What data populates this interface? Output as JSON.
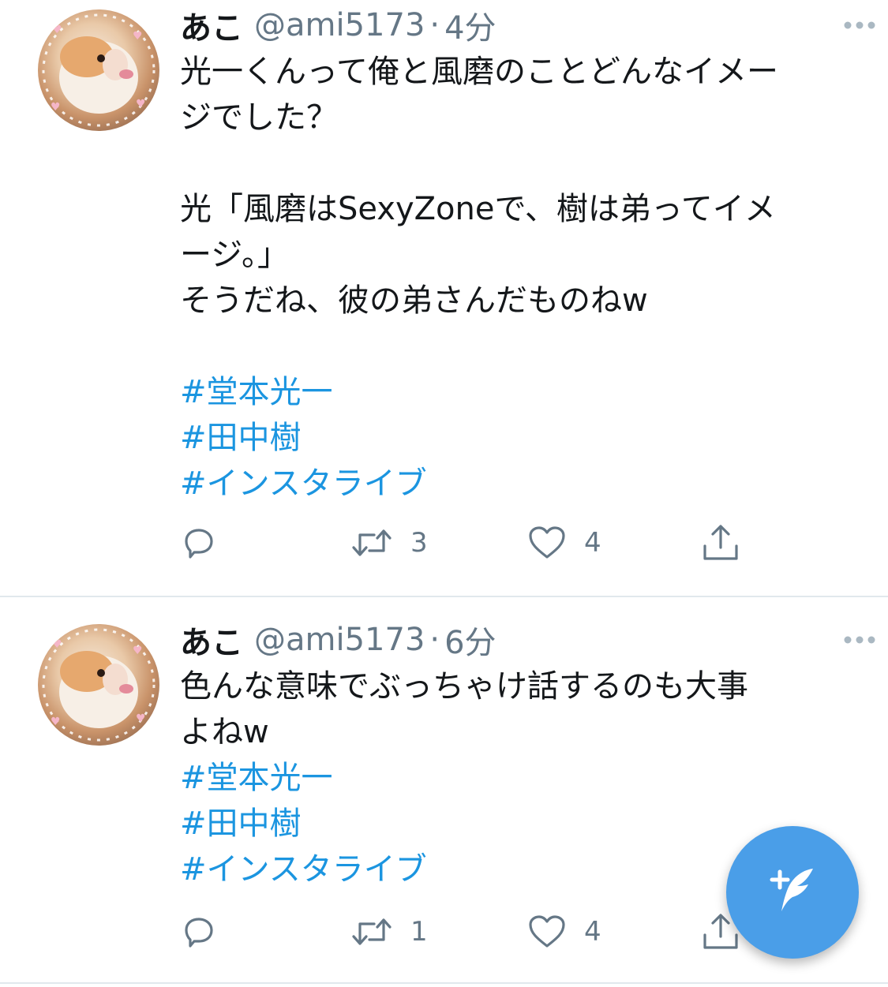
{
  "tweets": [
    {
      "display_name": "あこ",
      "handle": "@ami5173",
      "separator": "·",
      "time": "4分",
      "text_lines": [
        "光一くんって俺と風磨のことどんなイメー",
        "ジでした？",
        "",
        "光「風磨はSexyZoneで、樹は弟ってイメ",
        "ージ。」",
        "そうだね、彼の弟さんだものねw",
        ""
      ],
      "hashtags": [
        "#堂本光一",
        "#田中樹",
        "#インスタライブ"
      ],
      "retweets": "3",
      "likes": "4"
    },
    {
      "display_name": "あこ",
      "handle": "@ami5173",
      "separator": "·",
      "time": "6分",
      "text_lines": [
        "色んな意味でぶっちゃけ話するのも大事",
        "よねw"
      ],
      "hashtags": [
        "#堂本光一",
        "#田中樹",
        "#インスタライブ"
      ],
      "retweets": "1",
      "likes": "4"
    }
  ],
  "icons": {
    "more": "more-horizontal-icon",
    "reply": "reply-icon",
    "retweet": "retweet-icon",
    "like": "heart-icon",
    "share": "share-icon",
    "compose": "compose-tweet-icon"
  },
  "colors": {
    "hashtag": "#1b95e0",
    "secondary_text": "#657786",
    "fab": "#4a9ee8",
    "divider": "#e1e8ed"
  }
}
